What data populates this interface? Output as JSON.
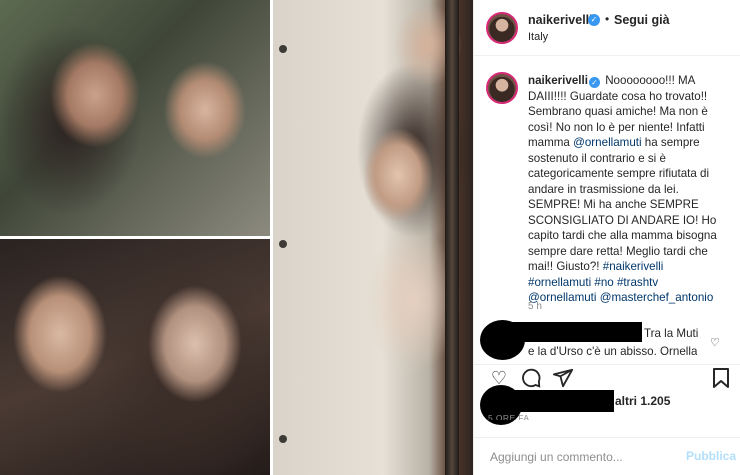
{
  "post": {
    "username": "naikerivelli",
    "follow_label": "Segui già",
    "separator": "•",
    "location": "Italy",
    "verified_glyph": "✓"
  },
  "caption": {
    "username": "naikerivelli",
    "part1": "Noooooooo!!! MA DAIII!!!! Guardate cosa ho trovato!! Sembrano quasi amiche! Ma non è così! No non lo è per niente! Infatti mamma ",
    "mention1": "@ornellamuti",
    "part2": " ha sempre sostenuto il contrario e si è categoricamente sempre rifiutata di andare in trasmissione da lei. SEMPRE! Mi ha anche SEMPRE SCONSIGLIATO DI ANDARE IO! Ho capito tardi che alla mamma bisogna sempre dare retta! Meglio tardi che mai!! Giusto?! ",
    "hashtags1": "#naikerivelli #ornellamuti #no #trashtv",
    "mentions_end": "@ornellamuti @masterchef_antonio",
    "time": "5 h"
  },
  "comment": {
    "text_line1": "Tra la Muti",
    "text_line2": "e la d'Urso c'è un abisso. Ornella",
    "heart": "♡"
  },
  "actions": {
    "like_icon": "heart-icon",
    "comment_icon": "comment-icon",
    "share_icon": "share-icon",
    "save_icon": "bookmark-icon",
    "like_glyph": "♡"
  },
  "likes": {
    "text": "altri 1.205",
    "time": "5 ORE FA"
  },
  "add_comment": {
    "placeholder": "Aggiungi un commento...",
    "publish_label": "Pubblica"
  }
}
